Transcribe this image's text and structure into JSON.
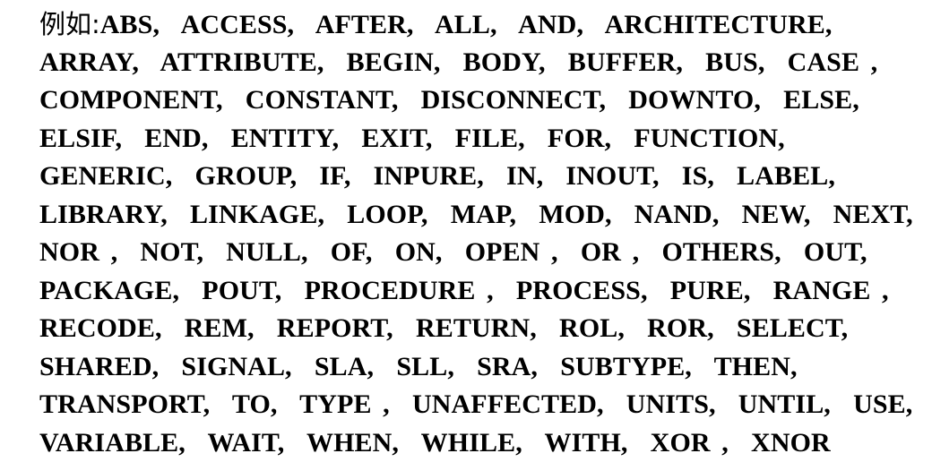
{
  "document": {
    "language_lead": "例如:",
    "lines": [
      "例如:  ABS,  ACCESS,  AFTER,  ALL,  AND,  ARCHITECTURE,",
      "ARRAY,  ATTRIBUTE,  BEGIN,  BODY,  BUFFER,  BUS,  CASE ,",
      "COMPONENT,  CONSTANT,  DISCONNECT,  DOWNTO,  ELSE,",
      "ELSIF,  END,  ENTITY,  EXIT,  FILE,  FOR,  FUNCTION,",
      "GENERIC,  GROUP,  IF,  INPURE,  IN,  INOUT,  IS,  LABEL,",
      "LIBRARY,  LINKAGE,  LOOP,  MAP,  MOD,  NAND,  NEW,  NEXT,",
      "NOR ,  NOT,  NULL,  OF,  ON,  OPEN ,  OR ,  OTHERS,  OUT,",
      "PACKAGE,  POUT,  PROCEDURE ,  PROCESS,  PURE,  RANGE ,",
      "RECODE,  REM,  REPORT,  RETURN,  ROL,  ROR,  SELECT,",
      "SHARED,  SIGNAL,  SLA,  SLL,  SRA,  SUBTYPE,  THEN,",
      "TRANSPORT,  TO,  TYPE ,  UNAFFECTED,  UNITS,  UNTIL,  USE,",
      "VARIABLE,  WAIT,  WHEN,  WHILE,  WITH,  XOR ,  XNOR"
    ],
    "line_1_latin": "ABS,  ACCESS,  AFTER,  ALL,  AND,  ARCHITECTURE,",
    "keywords": [
      "ABS",
      "ACCESS",
      "AFTER",
      "ALL",
      "AND",
      "ARCHITECTURE",
      "ARRAY",
      "ATTRIBUTE",
      "BEGIN",
      "BODY",
      "BUFFER",
      "BUS",
      "CASE",
      "COMPONENT",
      "CONSTANT",
      "DISCONNECT",
      "DOWNTO",
      "ELSE",
      "ELSIF",
      "END",
      "ENTITY",
      "EXIT",
      "FILE",
      "FOR",
      "FUNCTION",
      "GENERIC",
      "GROUP",
      "IF",
      "INPURE",
      "IN",
      "INOUT",
      "IS",
      "LABEL",
      "LIBRARY",
      "LINKAGE",
      "LOOP",
      "MAP",
      "MOD",
      "NAND",
      "NEW",
      "NEXT",
      "NOR",
      "NOT",
      "NULL",
      "OF",
      "ON",
      "OPEN",
      "OR",
      "OTHERS",
      "OUT",
      "PACKAGE",
      "POUT",
      "PROCEDURE",
      "PROCESS",
      "PURE",
      "RANGE",
      "RECODE",
      "REM",
      "REPORT",
      "RETURN",
      "ROL",
      "ROR",
      "SELECT",
      "SHARED",
      "SIGNAL",
      "SLA",
      "SLL",
      "SRA",
      "SUBTYPE",
      "THEN",
      "TRANSPORT",
      "TO",
      "TYPE",
      "UNAFFECTED",
      "UNITS",
      "UNTIL",
      "USE",
      "VARIABLE",
      "WAIT",
      "WHEN",
      "WHILE",
      "WITH",
      "XOR",
      "XNOR"
    ],
    "colors": {
      "background": "#ffffff",
      "text": "#000000"
    }
  }
}
